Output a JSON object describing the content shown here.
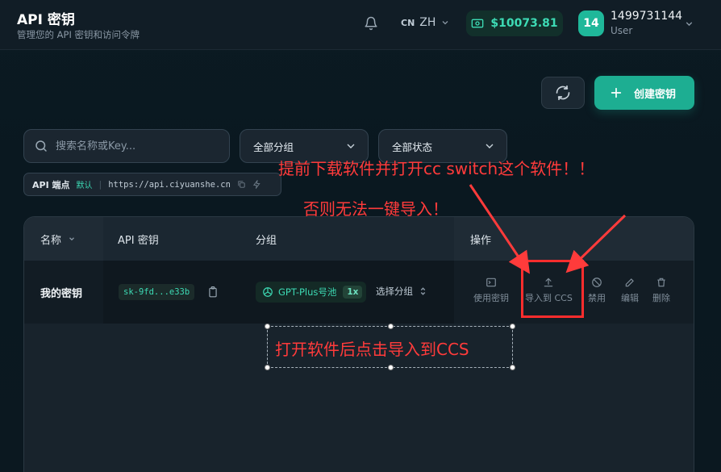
{
  "header": {
    "title": "API 密钥",
    "subtitle": "管理您的 API 密钥和访问令牌",
    "lang_code": "CN",
    "lang_label": "ZH",
    "balance": "$10073.81",
    "user": {
      "avatar_text": "14",
      "id": "1499731144",
      "role": "User"
    }
  },
  "toolbar": {
    "create_label": "创建密钥"
  },
  "filters": {
    "search_placeholder": "搜索名称或Key...",
    "group_select": "全部分组",
    "status_select": "全部状态"
  },
  "endpoint": {
    "label": "API 端点",
    "badge": "默认",
    "url": "https://api.ciyuanshe.cn"
  },
  "table": {
    "columns": {
      "name": "名称",
      "key": "API 密钥",
      "group": "分组",
      "actions": "操作"
    },
    "rows": [
      {
        "name": "我的密钥",
        "key": "sk-9fd...e33b",
        "group": "GPT-Plus号池",
        "multiplier": "1x",
        "select_group": "选择分组",
        "actions": [
          "使用密钥",
          "导入到 CCS",
          "禁用",
          "编辑",
          "删除"
        ]
      }
    ]
  },
  "annotations": {
    "line1": "提前下载软件并打开cc switch这个软件！！",
    "line2": "否则无法一键导入！",
    "line3": "打开软件后点击导入到CCS",
    "color": "#ff3b3b"
  },
  "colors": {
    "accent": "#1dae92",
    "accent_text": "#3ddbb5",
    "background": "#0b1a22"
  }
}
